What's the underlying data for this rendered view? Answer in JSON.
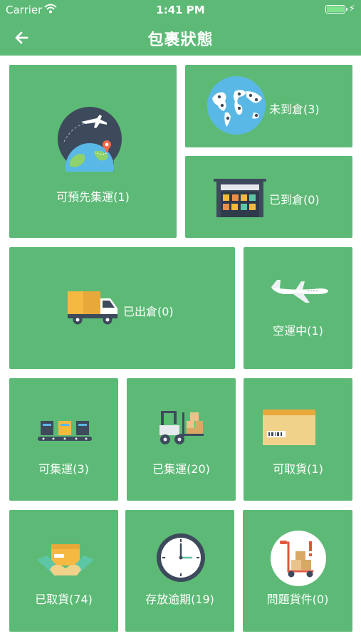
{
  "status_bar": {
    "carrier": "Carrier",
    "time": "1:41 PM",
    "battery_level": 1.0
  },
  "nav": {
    "title": "包裹狀態",
    "back_icon": "arrow-left-icon"
  },
  "tiles": {
    "prebook": {
      "label": "可預先集運(1)",
      "icon": "globe-airplane-icon"
    },
    "not_arrived": {
      "label": "未到倉(3)",
      "icon": "world-map-icon"
    },
    "arrived": {
      "label": "已到倉(0)",
      "icon": "warehouse-icon"
    },
    "shipped_out": {
      "label": "已出倉(0)",
      "icon": "delivery-truck-icon"
    },
    "in_air": {
      "label": "空運中(1)",
      "icon": "airplane-icon"
    },
    "consolidatable": {
      "label": "可集運(3)",
      "icon": "conveyor-boxes-icon"
    },
    "consolidated": {
      "label": "已集運(20)",
      "icon": "forklift-icon"
    },
    "ready_pickup": {
      "label": "可取貨(1)",
      "icon": "parcel-box-icon"
    },
    "picked_up": {
      "label": "已取貨(74)",
      "icon": "hands-package-icon"
    },
    "overdue": {
      "label": "存放逾期(19)",
      "icon": "clock-icon"
    },
    "problem": {
      "label": "問題貨件(0)",
      "icon": "hand-truck-alert-icon"
    }
  },
  "colors": {
    "primary_green": "#5dba76"
  }
}
